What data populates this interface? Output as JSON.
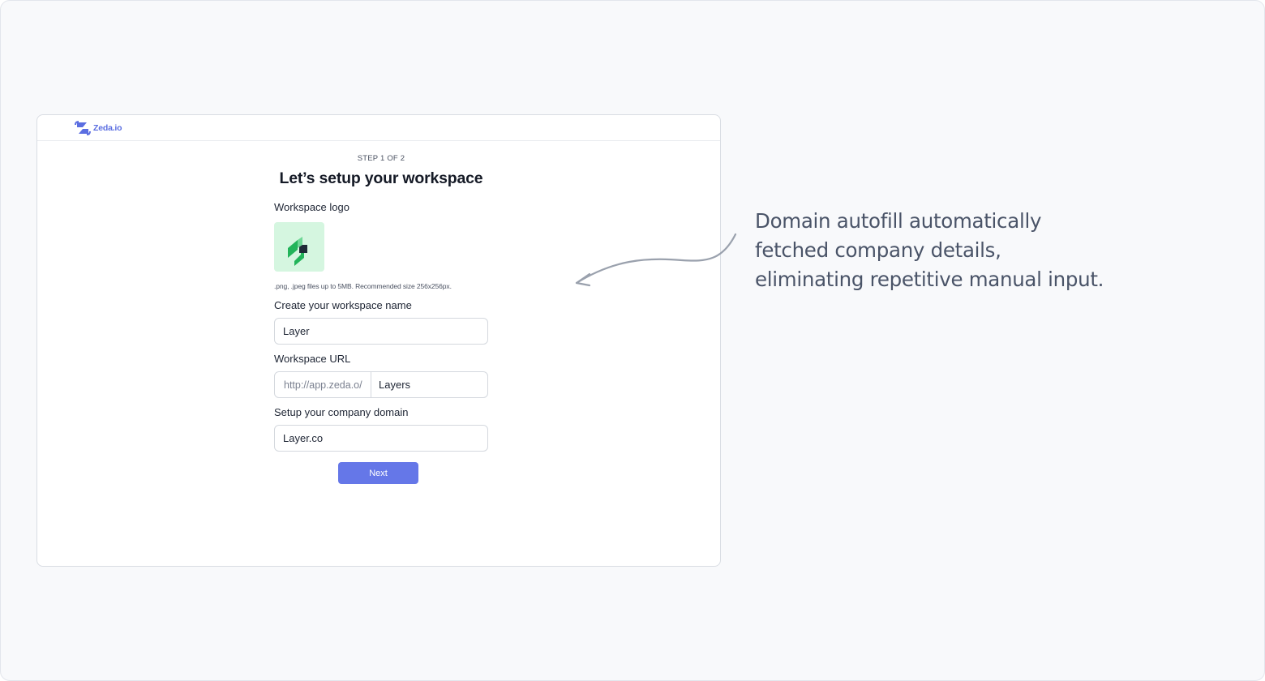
{
  "app": {
    "brand_name": "Zeda.io",
    "accent_color": "#6577e8"
  },
  "onboarding": {
    "step_text": "STEP 1 OF 2",
    "title": "Let’s setup your workspace",
    "logo_label": "Workspace logo",
    "logo_icon": "layer-logo-icon",
    "logo_hint": ".png, .jpeg files up to 5MB. Recommended size 256x256px.",
    "name_label": "Create your workspace name",
    "name_value": "Layer",
    "url_label": "Workspace URL",
    "url_prefix": "http://app.zeda.o/",
    "url_value": "Layers",
    "domain_label": "Setup your company domain",
    "domain_value": "Layer.co",
    "next_label": "Next"
  },
  "annotation": {
    "lines": [
      "Domain autofill automatically",
      "fetched company details,",
      "eliminating repetitive manual input."
    ],
    "arrow_icon": "curved-arrow-icon"
  }
}
